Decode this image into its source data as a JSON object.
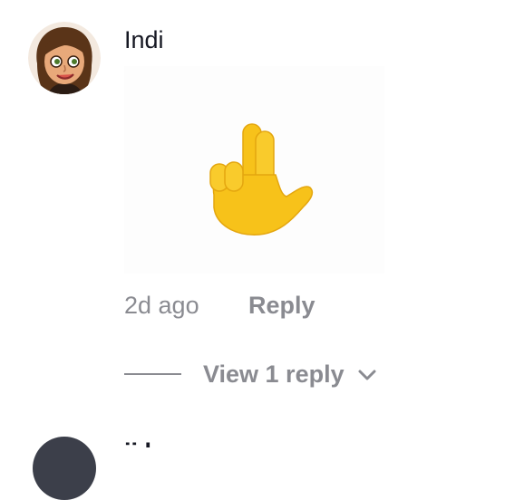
{
  "comment": {
    "username": "Indi",
    "time_ago": "2d ago",
    "reply_label": "Reply",
    "view_replies_label": "View 1 reply",
    "sticker_icon": "hand-fingers-icon",
    "avatar_icon": "girl-avatar-icon"
  },
  "next_comment": {
    "username_partial": "ji   l"
  },
  "colors": {
    "muted_text": "#8a8b91",
    "primary_text": "#161823",
    "emoji_yellow": "#f7c21a"
  }
}
